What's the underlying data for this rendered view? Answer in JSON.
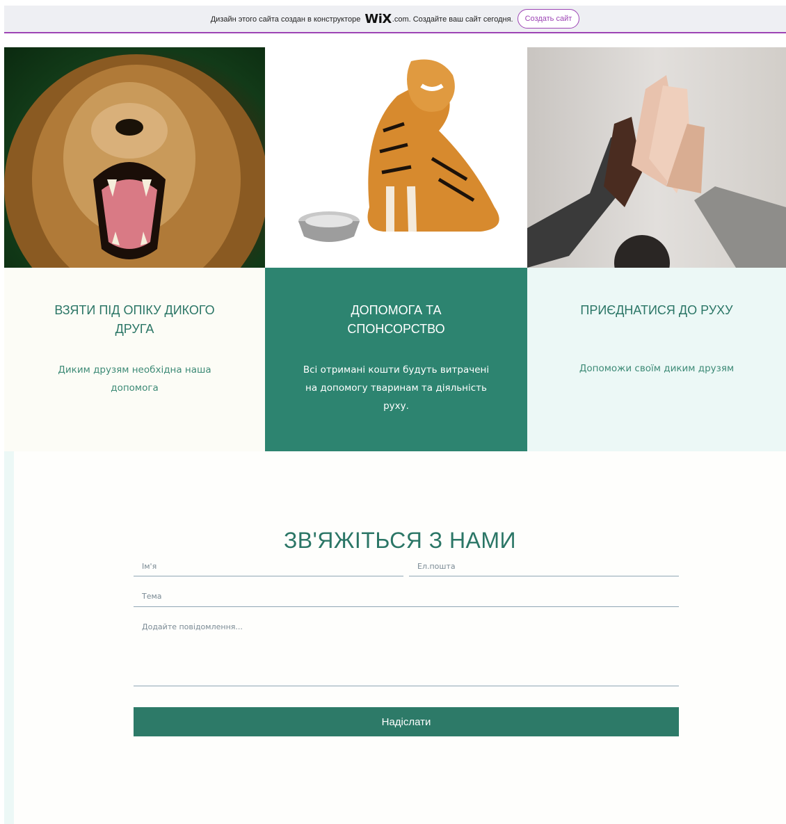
{
  "banner": {
    "text_before": "Дизайн этого сайта создан в конструкторе ",
    "logo": "WiX",
    "text_after": ".com. Создайте ваш сайт сегодня.",
    "cta_label": "Создать сайт",
    "accent": "#9d44b5"
  },
  "images": [
    {
      "subject": "lion"
    },
    {
      "subject": "tiger"
    },
    {
      "subject": "hands"
    }
  ],
  "cards": [
    {
      "title": "ВЗЯТИ ПІД ОПІКУ ДИКОГО ДРУГА",
      "text": "Диким друзям необхідна наша допомога",
      "bg": "#fcfcf6"
    },
    {
      "title": "ДОПОМОГА ТА СПОНСОРСТВО",
      "text": "Всі отримані кошти будуть витрачені на допомогу тваринам та діяльність руху.",
      "bg": "#2d8470"
    },
    {
      "title": "ПРИЄДНАТИСЯ ДО РУХУ",
      "text": "Допоможи своїм диким друзям",
      "bg": "#ecf8f6"
    }
  ],
  "contact": {
    "title": "ЗВ'ЯЖІТЬСЯ З НАМИ",
    "name_placeholder": "Ім'я",
    "email_placeholder": "Ел.пошта",
    "subject_placeholder": "Тема",
    "message_placeholder": "Додайте повідомлення...",
    "submit_label": "Надіслати",
    "accent": "#2d7a68"
  }
}
